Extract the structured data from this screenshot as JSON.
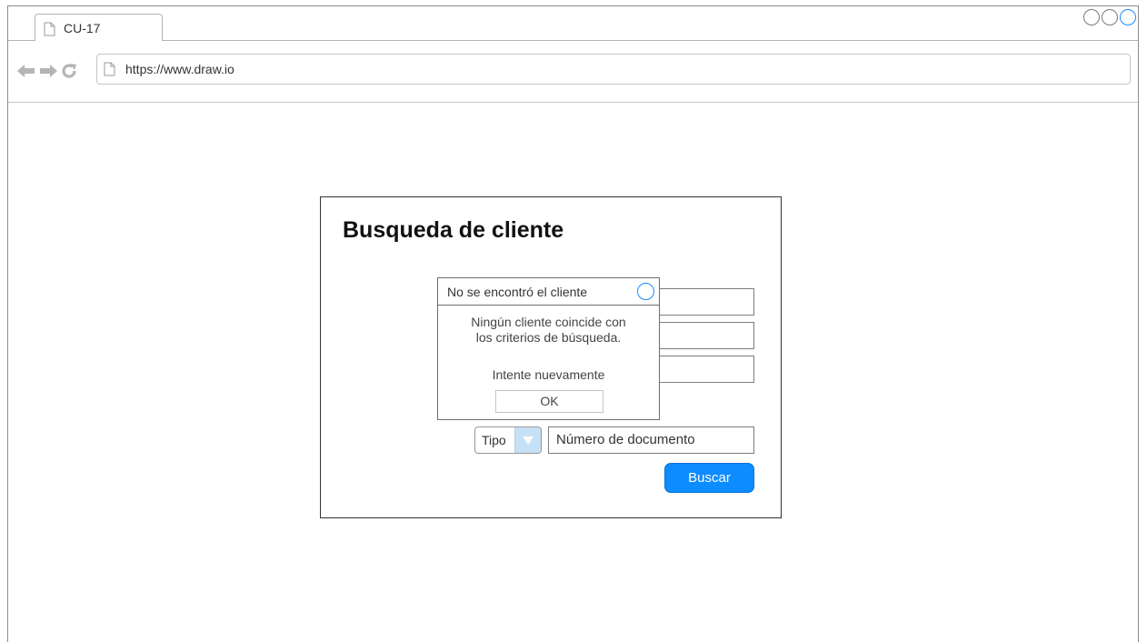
{
  "browser": {
    "tab_title": "CU-17",
    "url": "https://www.draw.io",
    "nav_icons": [
      "back-arrow-icon",
      "forward-arrow-icon",
      "reload-icon"
    ]
  },
  "form": {
    "title": "Busqueda de cliente",
    "tipo_label": "Tipo",
    "doc_number_placeholder": "Número de documento",
    "search_button": "Buscar"
  },
  "dialog": {
    "title": "No se encontró el cliente",
    "message_line1": "Ningún cliente coincide con",
    "message_line2": "los criterios de búsqueda.",
    "retry_text": "Intente nuevamente",
    "ok_button": "OK"
  },
  "colors": {
    "accent": "#0c8cff",
    "dropdown_button": "#c6e0f5",
    "nav_icon": "#b5b5b5"
  }
}
